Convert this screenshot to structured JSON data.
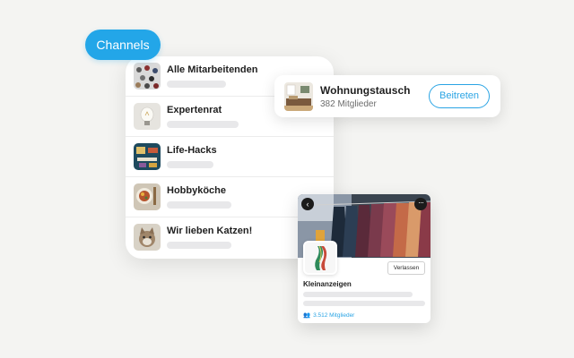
{
  "pill": {
    "label": "Channels"
  },
  "channels": [
    {
      "title": "Alle Mitarbeitenden",
      "icon": "people-crowd-photo"
    },
    {
      "title": "Expertenrat",
      "icon": "lightbulb-photo"
    },
    {
      "title": "Life-Hacks",
      "icon": "desk-tools-photo"
    },
    {
      "title": "Hobbyköche",
      "icon": "food-bowl-photo"
    },
    {
      "title": "Wir lieben Katzen!",
      "icon": "cat-photo"
    }
  ],
  "wohnungstausch": {
    "title": "Wohnungstausch",
    "members": "382 Mitglieder",
    "join_label": "Beitreten",
    "icon": "living-room-photo"
  },
  "kleinanzeigen": {
    "title": "Kleinanzeigen",
    "members": "3.512 Mitglieder",
    "leave_label": "Verlassen",
    "back_glyph": "‹",
    "more_glyph": "···",
    "people_glyph": "👥",
    "banner_icon": "clothing-rack-photo",
    "avatar_icon": "scarf-photo"
  },
  "colors": {
    "accent": "#23a6e8",
    "background": "#f4f4f2",
    "placeholder": "#e8e8ea"
  }
}
